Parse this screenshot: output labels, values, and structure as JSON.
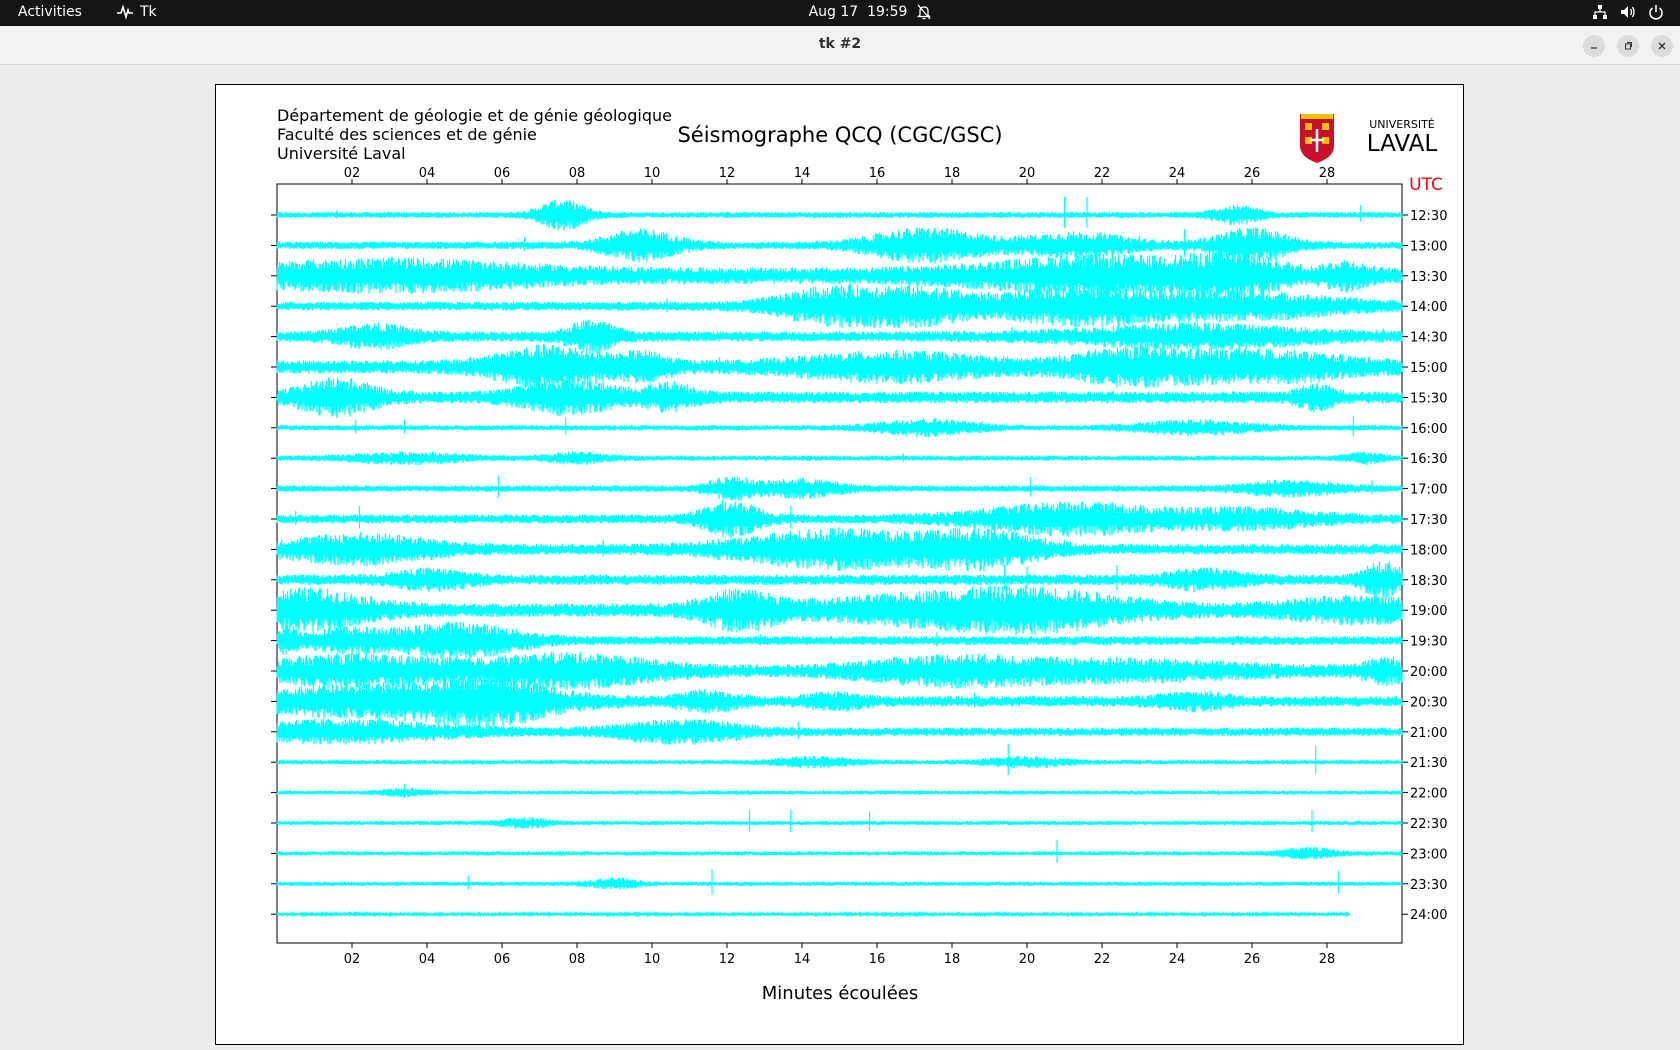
{
  "topbar": {
    "activities": "Activities",
    "app_name": "Tk",
    "clock": "Aug 17  19:59"
  },
  "icons": {
    "app_icon": "tk-app-icon",
    "notification": "bell-off-icon",
    "network": "network-icon",
    "volume": "volume-icon",
    "power": "power-icon",
    "minimize": "minimize-icon",
    "maximize": "maximize-icon",
    "close": "close-icon"
  },
  "window": {
    "title": "tk #2"
  },
  "seismogram": {
    "institution_lines": [
      "Département de géologie et de génie géologique",
      "Faculté des sciences et de génie",
      "Université Laval"
    ],
    "title": "Séismographe QCQ (CGC/GSC)",
    "logo_text_top": "UNIVERSITÉ",
    "logo_text_bottom": "LAVAL",
    "utc_label": "UTC",
    "x_label": "Minutes écoulées",
    "trace_color": "#00ffff"
  },
  "chart_data": {
    "type": "line",
    "title": "Séismographe QCQ (CGC/GSC)",
    "xlabel": "Minutes écoulées",
    "ylabel": "UTC",
    "xlim": [
      0,
      30
    ],
    "x_ticks": [
      "02",
      "04",
      "06",
      "08",
      "10",
      "12",
      "14",
      "16",
      "18",
      "20",
      "22",
      "24",
      "26",
      "28"
    ],
    "x_tick_values": [
      2,
      4,
      6,
      8,
      10,
      12,
      14,
      16,
      18,
      20,
      22,
      24,
      26,
      28
    ],
    "rows": [
      "12:30",
      "13:00",
      "13:30",
      "14:00",
      "14:30",
      "15:00",
      "15:30",
      "16:00",
      "16:30",
      "17:00",
      "17:30",
      "18:00",
      "18:30",
      "19:00",
      "19:30",
      "20:00",
      "20:30",
      "21:00",
      "21:30",
      "22:00",
      "22:30",
      "23:00",
      "23:30",
      "24:00"
    ],
    "last_row_end_minute": 28.6,
    "series_color": "#00ffff",
    "activity": [
      {
        "row": "12:30",
        "base": 0.2,
        "bursts": [
          [
            7.6,
            0.5,
            0.9
          ],
          [
            25.6,
            0.5,
            0.5
          ]
        ],
        "spikes": [
          [
            21.0,
            1.1
          ],
          [
            21.6,
            1.1
          ],
          [
            28.9,
            0.6
          ],
          [
            1.6,
            0.3
          ]
        ]
      },
      {
        "row": "13:00",
        "base": 0.25,
        "bursts": [
          [
            9.7,
            0.8,
            0.9
          ],
          [
            17.3,
            1.2,
            1.0
          ],
          [
            21.3,
            1.2,
            0.7
          ],
          [
            26.0,
            0.8,
            1.0
          ]
        ],
        "spikes": [
          [
            6.6,
            0.5
          ],
          [
            24.2,
            1.0
          ],
          [
            23.0,
            0.6
          ]
        ]
      },
      {
        "row": "13:30",
        "base": 0.55,
        "bursts": [
          [
            3.0,
            3.0,
            0.7
          ],
          [
            22.0,
            2.5,
            0.9
          ],
          [
            25.5,
            1.0,
            0.8
          ],
          [
            28.5,
            0.4,
            0.6
          ]
        ],
        "spikes": [
          [
            24.1,
            0.8
          ],
          [
            17.5,
            0.5
          ]
        ]
      },
      {
        "row": "14:00",
        "base": 0.3,
        "bursts": [
          [
            14.9,
            1.2,
            1.1
          ],
          [
            17.2,
            1.0,
            0.9
          ],
          [
            21.4,
            1.8,
            1.1
          ],
          [
            26.0,
            2.0,
            0.7
          ]
        ],
        "spikes": [
          [
            10.4,
            0.5
          ],
          [
            28.0,
            0.4
          ]
        ]
      },
      {
        "row": "14:30",
        "base": 0.35,
        "bursts": [
          [
            2.6,
            0.8,
            0.6
          ],
          [
            8.4,
            0.5,
            0.9
          ],
          [
            24.5,
            2.5,
            0.6
          ]
        ],
        "spikes": [
          [
            8.5,
            0.8
          ],
          [
            19.6,
            0.6
          ],
          [
            29.5,
            0.5
          ]
        ]
      },
      {
        "row": "15:00",
        "base": 0.45,
        "bursts": [
          [
            7.3,
            1.2,
            1.1
          ],
          [
            9.8,
            0.5,
            0.6
          ],
          [
            16.5,
            2.0,
            0.7
          ],
          [
            22.6,
            1.2,
            0.8
          ],
          [
            26.1,
            2.0,
            0.8
          ]
        ],
        "spikes": [
          [
            11.8,
            0.6
          ],
          [
            20.0,
            0.4
          ]
        ]
      },
      {
        "row": "15:30",
        "base": 0.4,
        "bursts": [
          [
            1.6,
            0.8,
            1.0
          ],
          [
            7.8,
            1.0,
            0.9
          ],
          [
            10.5,
            0.5,
            0.7
          ],
          [
            27.7,
            0.4,
            0.6
          ]
        ],
        "spikes": [
          [
            7.8,
            0.8
          ],
          [
            6.1,
            0.5
          ]
        ]
      },
      {
        "row": "16:00",
        "base": 0.18,
        "bursts": [
          [
            17.3,
            1.0,
            0.5
          ],
          [
            24.5,
            1.2,
            0.4
          ]
        ],
        "spikes": [
          [
            2.1,
            0.5
          ],
          [
            3.4,
            0.5
          ],
          [
            7.7,
            0.6
          ],
          [
            28.7,
            0.7
          ],
          [
            18.8,
            0.4
          ]
        ]
      },
      {
        "row": "16:30",
        "base": 0.17,
        "bursts": [
          [
            3.5,
            1.2,
            0.3
          ],
          [
            8.0,
            0.6,
            0.3
          ],
          [
            29.0,
            0.4,
            0.3
          ]
        ],
        "spikes": [
          [
            16.7,
            0.3
          ]
        ]
      },
      {
        "row": "17:00",
        "base": 0.22,
        "bursts": [
          [
            12.1,
            0.5,
            0.6
          ],
          [
            14.0,
            0.8,
            0.5
          ],
          [
            27.0,
            1.0,
            0.4
          ]
        ],
        "spikes": [
          [
            5.9,
            0.8
          ],
          [
            12.0,
            0.7
          ],
          [
            20.1,
            0.7
          ],
          [
            29.2,
            0.5
          ]
        ]
      },
      {
        "row": "17:30",
        "base": 0.3,
        "bursts": [
          [
            12.1,
            0.6,
            1.0
          ],
          [
            21.2,
            2.0,
            0.9
          ],
          [
            26.0,
            1.5,
            0.5
          ]
        ],
        "spikes": [
          [
            2.2,
            0.8
          ],
          [
            13.7,
            0.8
          ],
          [
            0.5,
            0.5
          ]
        ]
      },
      {
        "row": "18:00",
        "base": 0.35,
        "bursts": [
          [
            2.2,
            1.6,
            0.8
          ],
          [
            15.1,
            2.2,
            1.1
          ],
          [
            18.4,
            0.8,
            0.7
          ],
          [
            19.8,
            0.8,
            0.5
          ]
        ],
        "spikes": [
          [
            8.7,
            0.6
          ],
          [
            19.3,
            0.8
          ],
          [
            21.0,
            0.6
          ]
        ]
      },
      {
        "row": "18:30",
        "base": 0.35,
        "bursts": [
          [
            4.1,
            0.8,
            0.5
          ],
          [
            24.7,
            0.8,
            0.5
          ],
          [
            29.5,
            0.4,
            1.0
          ]
        ],
        "spikes": [
          [
            19.4,
            0.9
          ],
          [
            22.4,
            0.9
          ],
          [
            20.0,
            0.8
          ]
        ]
      },
      {
        "row": "19:00",
        "base": 0.45,
        "bursts": [
          [
            0.8,
            1.3,
            1.1
          ],
          [
            12.3,
            0.8,
            1.0
          ],
          [
            17.5,
            2.5,
            0.7
          ],
          [
            20.5,
            2.0,
            0.8
          ],
          [
            28.8,
            1.5,
            0.6
          ]
        ],
        "spikes": [
          [
            29.9,
            0.8
          ],
          [
            23.0,
            0.5
          ]
        ]
      },
      {
        "row": "19:30",
        "base": 0.3,
        "bursts": [
          [
            0.3,
            0.2,
            0.8
          ],
          [
            4.8,
            1.3,
            1.0
          ],
          [
            1.8,
            0.8,
            0.6
          ]
        ],
        "spikes": [
          [
            2.8,
            0.8
          ],
          [
            5.8,
            0.8
          ],
          [
            6.3,
            0.6
          ],
          [
            17.6,
            0.5
          ],
          [
            12.9,
            0.4
          ]
        ]
      },
      {
        "row": "20:00",
        "base": 0.4,
        "bursts": [
          [
            2.0,
            2.0,
            0.8
          ],
          [
            7.8,
            1.8,
            0.9
          ],
          [
            17.9,
            1.8,
            0.7
          ],
          [
            22.6,
            2.5,
            0.5
          ],
          [
            29.6,
            0.5,
            0.6
          ]
        ],
        "spikes": [
          [
            11.0,
            0.4
          ],
          [
            15.2,
            0.5
          ]
        ]
      },
      {
        "row": "20:30",
        "base": 0.35,
        "bursts": [
          [
            2.8,
            3.0,
            0.9
          ],
          [
            5.8,
            1.2,
            0.9
          ],
          [
            11.5,
            0.6,
            0.5
          ],
          [
            14.9,
            0.6,
            0.4
          ],
          [
            24.5,
            0.8,
            0.4
          ]
        ],
        "spikes": [
          [
            18.6,
            0.5
          ],
          [
            0.2,
            0.7
          ]
        ]
      },
      {
        "row": "21:00",
        "base": 0.28,
        "bursts": [
          [
            1.5,
            2.5,
            0.6
          ],
          [
            10.0,
            1.0,
            0.4
          ],
          [
            11.5,
            1.0,
            0.4
          ]
        ],
        "spikes": [
          [
            0.8,
            0.7
          ],
          [
            5.4,
            0.5
          ],
          [
            13.9,
            0.6
          ]
        ]
      },
      {
        "row": "21:30",
        "base": 0.15,
        "bursts": [
          [
            14.3,
            0.8,
            0.3
          ],
          [
            20.0,
            0.8,
            0.3
          ]
        ],
        "spikes": [
          [
            19.5,
            1.1
          ],
          [
            27.7,
            1.0
          ]
        ]
      },
      {
        "row": "22:00",
        "base": 0.13,
        "bursts": [
          [
            3.4,
            0.5,
            0.2
          ]
        ],
        "spikes": [
          [
            3.4,
            0.5
          ]
        ]
      },
      {
        "row": "22:30",
        "base": 0.14,
        "bursts": [
          [
            6.6,
            0.5,
            0.3
          ]
        ],
        "spikes": [
          [
            12.6,
            0.8
          ],
          [
            13.7,
            0.8
          ],
          [
            15.8,
            0.7
          ],
          [
            27.6,
            0.8
          ]
        ]
      },
      {
        "row": "23:00",
        "base": 0.14,
        "bursts": [
          [
            27.5,
            0.6,
            0.3
          ]
        ],
        "spikes": [
          [
            20.8,
            0.8
          ]
        ]
      },
      {
        "row": "23:30",
        "base": 0.14,
        "bursts": [
          [
            9.0,
            0.5,
            0.3
          ]
        ],
        "spikes": [
          [
            5.1,
            0.5
          ],
          [
            11.6,
            0.9
          ],
          [
            28.3,
            0.8
          ]
        ]
      },
      {
        "row": "24:00",
        "base": 0.1,
        "bursts": [],
        "spikes": []
      }
    ]
  }
}
